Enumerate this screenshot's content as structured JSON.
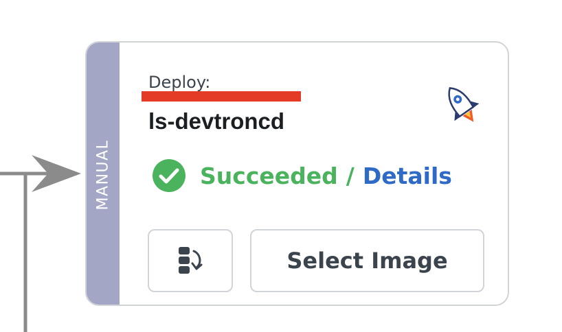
{
  "node": {
    "trigger_type": "MANUAL",
    "stage_label": "Deploy:",
    "pipeline_name": "ls-devtroncd",
    "status": "Succeeded",
    "status_separator": "/",
    "details_label": "Details",
    "select_image_label": "Select Image",
    "icons": {
      "deploy": "rocket-icon",
      "status": "check-circle-icon",
      "rollback": "rollback-icon"
    },
    "colors": {
      "strip": "#a3a6c4",
      "success": "#4bb35e",
      "link": "#2f6ac6",
      "redaction": "#e33b26"
    }
  }
}
